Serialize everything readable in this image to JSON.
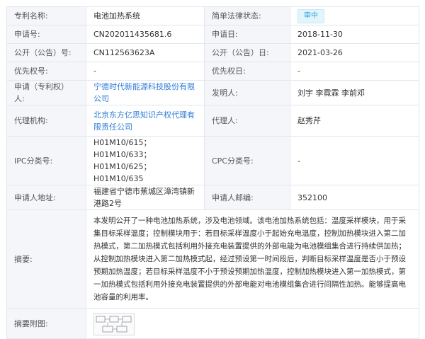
{
  "rows": {
    "name_label": "专利名称:",
    "name_value": "电池加热系统",
    "status_label": "简单法律状态:",
    "status_value": "审中",
    "appno_label": "申请号:",
    "appno_value": "CN202011435681.6",
    "appdate_label": "申请日:",
    "appdate_value": "2018-11-30",
    "pubno_label": "公开（公告）号:",
    "pubno_value": "CN112563623A",
    "pubdate_label": "公开（公告）日:",
    "pubdate_value": "2021-03-26",
    "priono_label": "优先权号:",
    "priono_value": "-",
    "priodate_label": "优先权日:",
    "priodate_value": "-",
    "applicant_label": "申请（专利权）人:",
    "applicant_value": "宁德时代新能源科技股份有限公司",
    "inventor_label": "发明人:",
    "inventor_value": "刘宇 李霓霖 李前邓",
    "agency_label": "代理机构:",
    "agency_value": "北京东方亿思知识产权代理有限责任公司",
    "agent_label": "代理人:",
    "agent_value": "赵秀芹",
    "ipc_label": "IPC分类号:",
    "ipc_value": "H01M10/615； H01M10/633； H01M10/625； H01M10/635",
    "cpc_label": "CPC分类号:",
    "cpc_value": "-",
    "address_label": "申请人地址:",
    "address_value": "福建省宁德市蕉城区漳湾镇新港路2号",
    "postcode_label": "申请人邮编:",
    "postcode_value": "352100",
    "abstract_label": "摘要:",
    "abstract_value": "本发明公开了一种电池加热系统，涉及电池领域。该电池加热系统包括：温度采样模块，用于采集目标采样温度；控制模块用于：若目标采样温度小于起始充电温度，控制加热模块进入第二加热模式，第二加热模式包括利用外接充电装置提供的外部电能为电池模组集合进行持续供加热；从控制加热模块进入第二加热模式起，经过预设第一时间段后，判断目标采样温度是否小于预设预期加热温度；若目标采样温度不小于预设预期加热温度，控制加热模块进入第一加热模式，第一加热模式包括利用外接充电装置提供的外部电能对电池模组集合进行间隔性加热。能够提高电池容量的利用率。",
    "figure_label": "摘要附图:"
  },
  "colors": {
    "label_bg": "#f4f6fa",
    "border": "#e3e6ec",
    "link": "#2f7cd6",
    "badge_text": "#2ba1d8",
    "badge_bg": "#e2f4fc"
  }
}
